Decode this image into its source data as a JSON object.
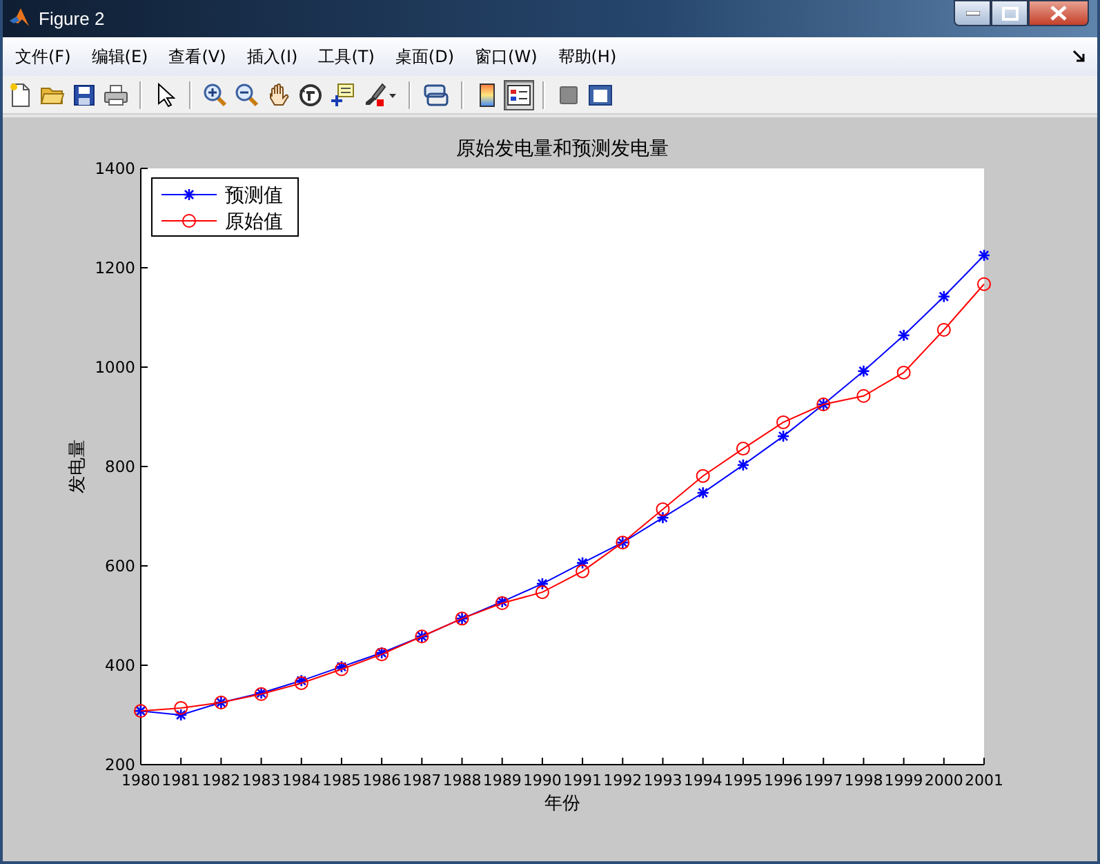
{
  "window": {
    "title": "Figure 2"
  },
  "menu": [
    "文件(F)",
    "编辑(E)",
    "查看(V)",
    "插入(I)",
    "工具(T)",
    "桌面(D)",
    "窗口(W)",
    "帮助(H)"
  ],
  "toolbar": [
    {
      "kind": "new",
      "pressed": false
    },
    {
      "kind": "open",
      "pressed": false
    },
    {
      "kind": "save",
      "pressed": false
    },
    {
      "kind": "print",
      "pressed": false
    },
    {
      "kind": "separator"
    },
    {
      "kind": "pointer",
      "pressed": false
    },
    {
      "kind": "separator"
    },
    {
      "kind": "zoom-in",
      "pressed": false
    },
    {
      "kind": "zoom-out",
      "pressed": false
    },
    {
      "kind": "pan",
      "pressed": false
    },
    {
      "kind": "rotate",
      "pressed": false
    },
    {
      "kind": "data-cursor",
      "pressed": false
    },
    {
      "kind": "brush",
      "pressed": false
    },
    {
      "kind": "separator"
    },
    {
      "kind": "link",
      "pressed": false
    },
    {
      "kind": "separator"
    },
    {
      "kind": "colorbar",
      "pressed": false
    },
    {
      "kind": "legend",
      "pressed": true
    },
    {
      "kind": "separator"
    },
    {
      "kind": "square",
      "pressed": false
    },
    {
      "kind": "frame",
      "pressed": false
    }
  ],
  "figure": {
    "chart_data": {
      "type": "line",
      "title": "原始发电量和预测发电量",
      "xlabel": "年份",
      "ylabel": "发电量",
      "categories": [
        "1980",
        "1981",
        "1982",
        "1983",
        "1984",
        "1985",
        "1986",
        "1987",
        "1988",
        "1989",
        "1990",
        "1991",
        "1992",
        "1993",
        "1994",
        "1995",
        "1996",
        "1997",
        "1998",
        "1999",
        "2000",
        "2001"
      ],
      "series": [
        {
          "name": "预测值",
          "color": "#0000ff",
          "marker": "cross",
          "values": [
            308,
            300,
            325,
            344,
            369,
            397,
            425,
            458,
            494,
            528,
            564,
            606,
            647,
            697,
            747,
            803,
            861,
            925,
            992,
            1064,
            1142,
            1225
          ]
        },
        {
          "name": "原始值",
          "color": "#ff0000",
          "marker": "circle",
          "values": [
            308,
            314,
            325,
            342,
            364,
            392,
            422,
            458,
            494,
            525,
            547,
            589,
            647,
            714,
            781,
            836,
            889,
            925,
            942,
            989,
            1075,
            1167
          ]
        }
      ],
      "legend": true,
      "ylim": [
        200,
        1400
      ],
      "yticks": [
        200,
        400,
        600,
        800,
        1000,
        1200,
        1400
      ]
    }
  }
}
